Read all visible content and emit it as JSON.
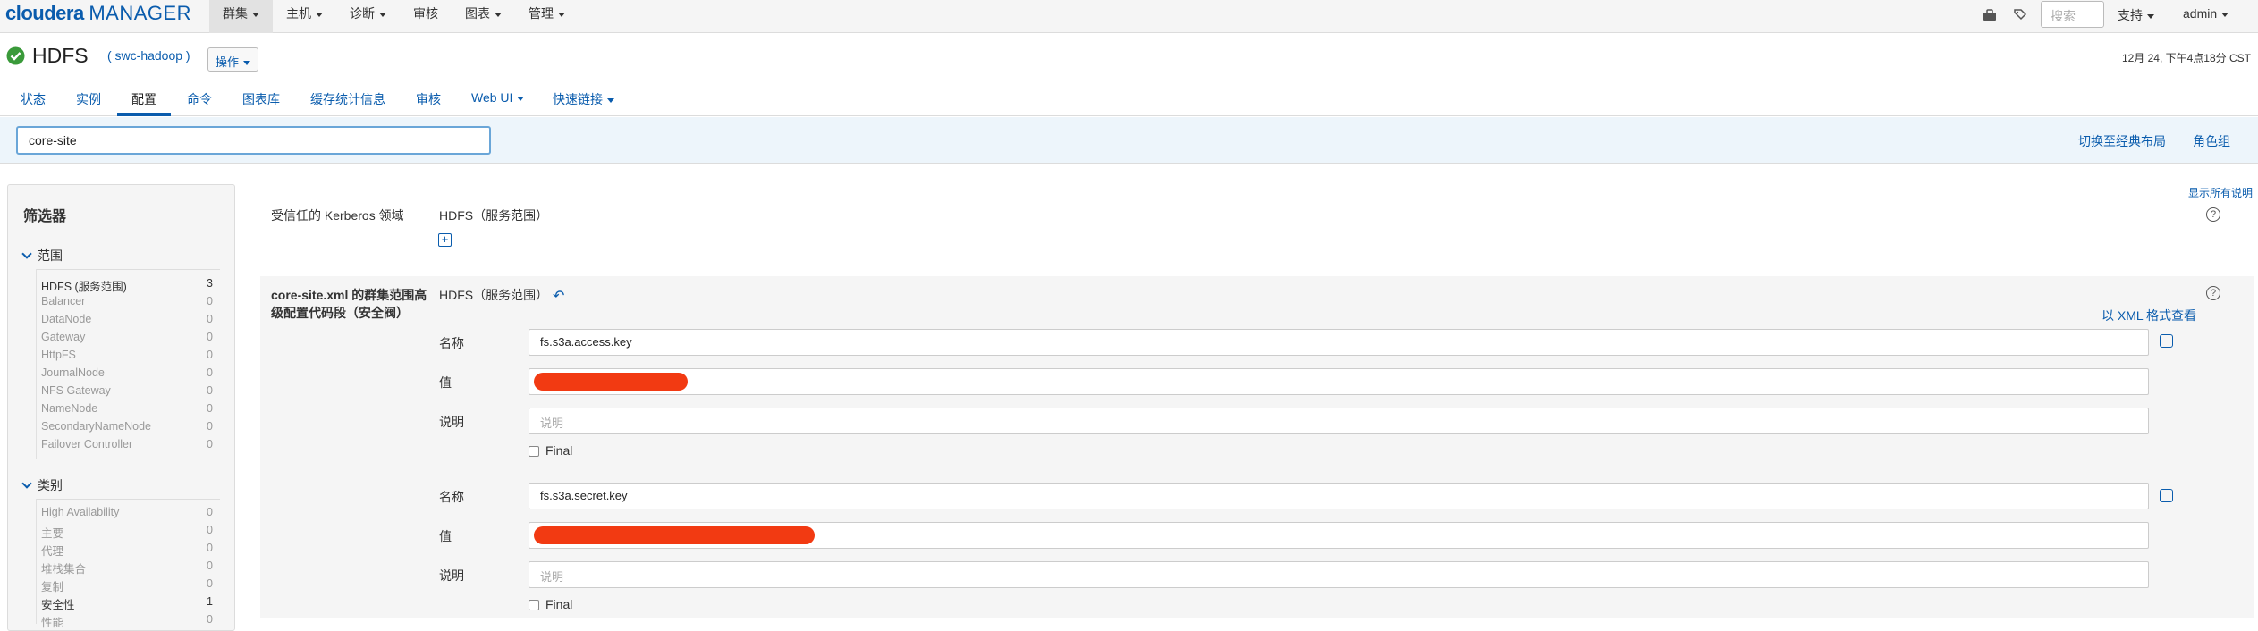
{
  "nav": {
    "logo_brand": "cloudera",
    "logo_product": "MANAGER",
    "menu": [
      {
        "label": "群集",
        "dropdown": true,
        "active": true
      },
      {
        "label": "主机",
        "dropdown": true
      },
      {
        "label": "诊断",
        "dropdown": true
      },
      {
        "label": "审核",
        "dropdown": false
      },
      {
        "label": "图表",
        "dropdown": true
      },
      {
        "label": "管理",
        "dropdown": true
      }
    ],
    "search_placeholder": "搜索",
    "support_label": "支持",
    "user_label": "admin",
    "icons": [
      "briefcase-icon",
      "tag-icon"
    ]
  },
  "service": {
    "status_icon": "check-circle-icon",
    "status_color": "#3a9a3a",
    "name": "HDFS",
    "cluster": "( swc-hadoop )",
    "actions_label": "操作",
    "datetime": "12月 24, 下午4点18分 CST"
  },
  "tabs": [
    {
      "label": "状态"
    },
    {
      "label": "实例"
    },
    {
      "label": "配置",
      "active": true
    },
    {
      "label": "命令"
    },
    {
      "label": "图表库"
    },
    {
      "label": "缓存统计信息"
    },
    {
      "label": "审核"
    },
    {
      "label": "Web UI",
      "dropdown": true
    },
    {
      "label": "快速链接",
      "dropdown": true
    }
  ],
  "filterbar": {
    "search_value": "core-site",
    "switch_layout_label": "切换至经典布局",
    "role_groups_label": "角色组"
  },
  "sidebar": {
    "title": "筛选器",
    "scope_heading": "范围",
    "scope_items": [
      {
        "label": "HDFS (服务范围)",
        "count": "3",
        "dark": true
      },
      {
        "label": "Balancer",
        "count": "0"
      },
      {
        "label": "DataNode",
        "count": "0"
      },
      {
        "label": "Gateway",
        "count": "0"
      },
      {
        "label": "HttpFS",
        "count": "0"
      },
      {
        "label": "JournalNode",
        "count": "0"
      },
      {
        "label": "NFS Gateway",
        "count": "0"
      },
      {
        "label": "NameNode",
        "count": "0"
      },
      {
        "label": "SecondaryNameNode",
        "count": "0"
      },
      {
        "label": "Failover Controller",
        "count": "0"
      }
    ],
    "category_heading": "类别",
    "category_items": [
      {
        "label": "High Availability",
        "count": "0"
      },
      {
        "label": "主要",
        "count": "0"
      },
      {
        "label": "代理",
        "count": "0"
      },
      {
        "label": "堆栈集合",
        "count": "0"
      },
      {
        "label": "复制",
        "count": "0"
      },
      {
        "label": "安全性",
        "count": "1",
        "dark": true
      },
      {
        "label": "性能",
        "count": "0"
      }
    ]
  },
  "main": {
    "show_all_label": "显示所有说明",
    "kerberos": {
      "label": "受信任的 Kerberos 领域",
      "scope": "HDFS（服务范围）"
    },
    "coresite": {
      "label_line1": "core-site.xml 的群集范围高",
      "label_line2": "级配置代码段（安全阀）",
      "scope": "HDFS（服务范围）",
      "xml_link": "以 XML 格式查看",
      "entries": [
        {
          "name_label": "名称",
          "name_value": "fs.s3a.access.key",
          "value_label": "值",
          "value_redacted": true,
          "desc_label": "说明",
          "desc_placeholder": "说明",
          "final_label": "Final"
        },
        {
          "name_label": "名称",
          "name_value": "fs.s3a.secret.key",
          "value_label": "值",
          "value_redacted": true,
          "desc_label": "说明",
          "desc_placeholder": "说明",
          "final_label": "Final"
        }
      ]
    }
  },
  "colors": {
    "link_blue": "#0a5cad",
    "redaction": "#f23a12",
    "search_row_bg": "#edf5fb"
  }
}
